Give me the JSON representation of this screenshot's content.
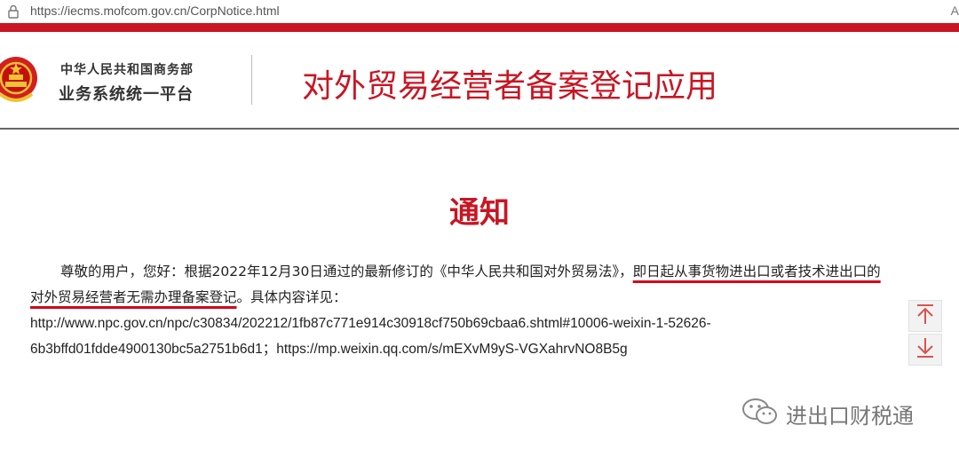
{
  "browser": {
    "url": "https://iecms.mofcom.gov.cn/CorpNotice.html",
    "right_icon_text": "A"
  },
  "header": {
    "org_name": "中华人民共和国商务部",
    "platform_name": "业务系统统一平台",
    "app_title": "对外贸易经营者备案登记应用"
  },
  "notice": {
    "title": "通知",
    "line1_plain": "尊敬的用户，您好：根据2022年12月30日通过的最新修订的《中华人民共和国对外贸易法》，",
    "line1_underlined": "即日起从事货物进出口或者技术进出口的",
    "line2_underlined": "对外贸易经营者无需办理备案登记",
    "line2_plain": "。具体内容详见：",
    "url_line1": "http://www.npc.gov.cn/npc/c30834/202212/1fb87c771e914c30918cf750b69cbaa6.shtml#10006-weixin-1-52626-",
    "url_line2": "6b3bffd01fdde4900130bc5a2751b6d1；https://mp.weixin.qq.com/s/mEXvM9yS-VGXahrvNO8B5g"
  },
  "controls": {
    "scroll_up_icon": "arrow-up-icon",
    "scroll_down_icon": "arrow-down-icon"
  },
  "watermark": {
    "icon": "wechat-icon",
    "text": "进出口财税通"
  },
  "colors": {
    "brand_red": "#c81623",
    "underline_red": "#d3061b"
  }
}
